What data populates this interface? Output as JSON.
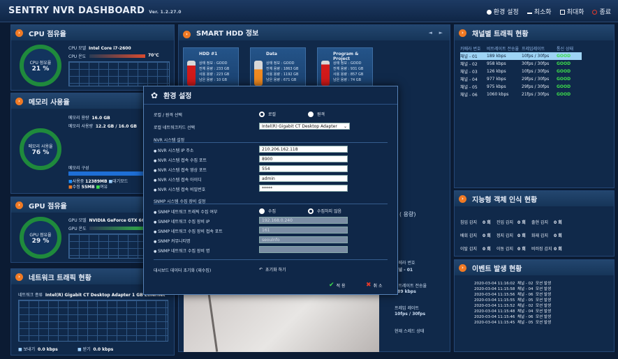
{
  "window": {
    "title": "SENTRY NVR DASHBOARD",
    "version": "Ver. 1.2.27.0",
    "controls": [
      "환경 설정",
      "최소화",
      "최대화",
      "종료"
    ]
  },
  "colors": {
    "accent": "#f07a24",
    "good": "#3ee04c",
    "gauge": "#1f8a3c"
  },
  "cpu": {
    "title": "CPU 점유율",
    "gauge_label": "CPU 점유율",
    "percent": "21 %",
    "model_label": "CPU 모델",
    "model": "Intel Core i7-2600",
    "temp_label": "CPU 온도",
    "temp": "70℃"
  },
  "memory": {
    "title": "메모리 사용율",
    "gauge_label": "메모리 사용율",
    "percent": "76 %",
    "cap_label": "메모리 용량",
    "cap": "16.0 GB",
    "used_label": "메모리 사용량",
    "used": "12.2 GB / 16.0 GB",
    "layout_label": "메모리 구성",
    "legend": [
      {
        "k": "사용중",
        "v": "12389MB"
      },
      {
        "k": "대기모드",
        "v": ""
      },
      {
        "k": "수정",
        "v": "55MB"
      },
      {
        "k": "여유",
        "v": ""
      }
    ]
  },
  "gpu": {
    "title": "GPU 점유율",
    "gauge_label": "GPU 점유율",
    "percent": "29 %",
    "model_label": "GPU 모델",
    "model": "NVIDIA GeForce GTX 660",
    "usage_label": "GPU 온도"
  },
  "network": {
    "title": "네트워크 트래픽 현황",
    "type_label": "네트워크 종류",
    "type": "Intel(R) Gigabit CT Desktop Adapter 1 GB Ethernet",
    "send_label": "보내기",
    "send": "0.0 kbps",
    "recv_label": "받기",
    "recv": "0.0 kbps"
  },
  "hdd": {
    "title": "SMART HDD 정보",
    "nav_prev": "◄",
    "nav_next": "►",
    "drives": [
      {
        "name": "HDD #1",
        "lines": [
          "상태 정보 : GOOD",
          "전체 용량 : 233 GB",
          "사용 용량 : 223 GB",
          "남은 용량 : 10 GB",
          "온도 정보 : 0"
        ]
      },
      {
        "name": "Data",
        "lines": [
          "상태 정보 : GOOD",
          "전체 용량 : 1863 GB",
          "사용 용량 : 1192 GB",
          "남은 용량 : 671 GB",
          "온도 정보 : 0"
        ]
      },
      {
        "name": "Program & Project",
        "lines": [
          "상태 정보 : GOOD",
          "전체 용량 : 931 GB",
          "사용 용량 : 857 GB",
          "남은 용량 : 74 GB",
          "온도 정보 : 0"
        ]
      }
    ]
  },
  "channel": {
    "title": "채널별 트래픽 현황",
    "headers": [
      "카메라 번호",
      "비트레이트 전송율",
      "프레임레이트",
      "통신 상태"
    ],
    "rows": [
      [
        "채널 - 01",
        "189 kbps",
        "10fps / 30fps",
        "GOOD"
      ],
      [
        "채널 - 02",
        "958 kbps",
        "30fps / 30fps",
        "GOOD"
      ],
      [
        "채널 - 03",
        "126 kbps",
        "10fps / 30fps",
        "GOOD"
      ],
      [
        "채널 - 04",
        "977 kbps",
        "29fps / 30fps",
        "GOOD"
      ],
      [
        "채널 - 05",
        "975 kbps",
        "29fps / 30fps",
        "GOOD"
      ],
      [
        "채널 - 06",
        "1060 kbps",
        "21fps / 30fps",
        "GOOD"
      ]
    ]
  },
  "objects": {
    "title": "지능형 객체 인식 현황",
    "items": [
      [
        "침입 감지",
        "0 회",
        "진입 감지",
        "0 회",
        "출현 감지",
        "0 회"
      ],
      [
        "배회 감지",
        "0 회",
        "정지 감지",
        "0 회",
        "화재 감지",
        "0 회"
      ],
      [
        "이탈 감지",
        "0 회",
        "이동 감지",
        "0 회",
        "비러징 감지",
        "0 회"
      ]
    ]
  },
  "events": {
    "title": "이벤트 발생 현황",
    "rows": [
      [
        "2020-03-04 11:16:02",
        "채널 - 02",
        "모션 발생"
      ],
      [
        "2020-03-04 11:15:58",
        "채널 - 04",
        "모션 발생"
      ],
      [
        "2020-03-04 11:15:56",
        "채널 - 06",
        "모션 발생"
      ],
      [
        "2020-03-04 11:15:55",
        "채널 - 05",
        "모션 발생"
      ],
      [
        "2020-03-04 11:15:52",
        "채널 - 02",
        "모션 발생"
      ],
      [
        "2020-03-04 11:15:48",
        "채널 - 04",
        "모션 발생"
      ],
      [
        "2020-03-04 11:15:46",
        "채널 - 06",
        "모션 발생"
      ],
      [
        "2020-03-04 11:15:45",
        "채널 - 05",
        "모션 발생"
      ]
    ]
  },
  "bgcenter": {
    "used_suffix": "( 용량)",
    "cam_label": "카메라 번호",
    "cam": "채널 - 01",
    "bitrate_label": "비트레이트 전송율",
    "bitrate": "189 kbps",
    "frame_label": "프레임 레이트",
    "frame": "10fps / 30fps",
    "state_label": "현재 스레드 상태"
  },
  "settings": {
    "title": "환경 설정",
    "mode_label": "로컬 / 원격 선택",
    "mode_local": "로컬",
    "mode_remote": "원격",
    "nic_label": "로컬 네트워크카드 선택",
    "nic": "Intel(R) Gigabit CT Desktop Adapter",
    "nvr_section": "NVR 시스템 설정",
    "nvr_ip_label": "NVR 시스템 IP 주소",
    "nvr_ip": "210.206.162.118",
    "nvr_port_label": "NVR 시스템 접속 수집 포트",
    "nvr_port": "8900",
    "nvr_vport_label": "NVR 시스템 접속 영상 포트",
    "nvr_vport": "554",
    "nvr_id_label": "NVR 시스템 접속 아이디",
    "nvr_id": "admin",
    "nvr_pw_label": "NVR 시스템 접속 비밀번호",
    "nvr_pw": "*****",
    "snmp_section": "SNMP 시스템 수집 장비 설정",
    "snmp_enable_label": "SNMP 네트워크 트래픽 수집 여부",
    "snmp_on": "수집",
    "snmp_off": "수집하지 않음",
    "snmp_ip_label": "SNMP 네트워크 수집 장비 IP",
    "snmp_ip": "192.168.0.240",
    "snmp_port_label": "SNMP 네트워크 수집 장비 접속 포트",
    "snmp_port": "161",
    "snmp_comm_label": "SNMP 커뮤니티명",
    "snmp_comm": "seoulnfo",
    "snmp_name_label": "SNMP 네트워크 수집 장비 명",
    "snmp_name": "",
    "reset_label": "대시보드 데이터 초기화 (재수집)",
    "reset_btn": "초기화 하기",
    "apply": "적 용",
    "cancel": "취 소"
  }
}
